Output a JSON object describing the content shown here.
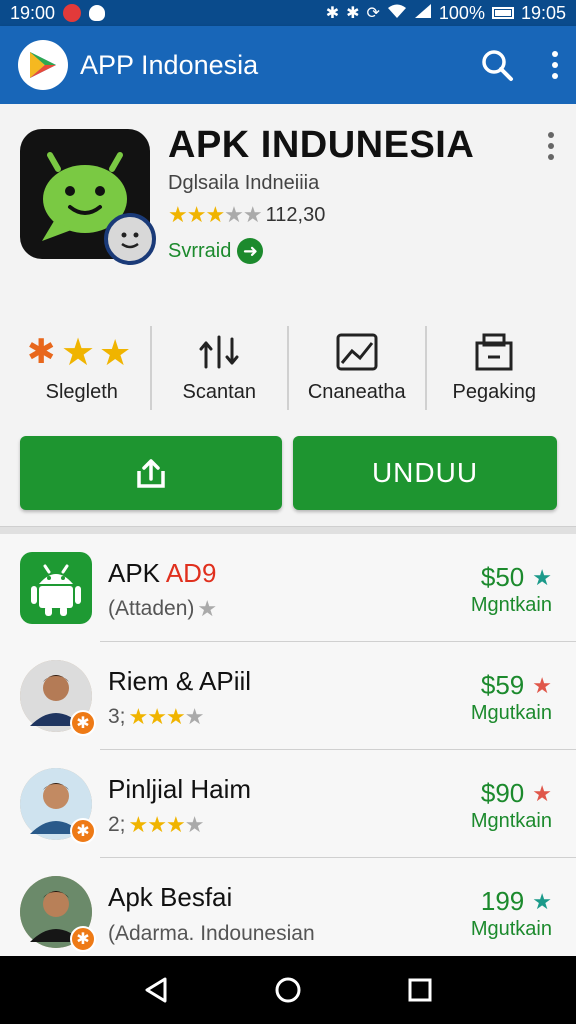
{
  "status_bar": {
    "time_left": "19:00",
    "battery": "100%",
    "time_right": "19:05"
  },
  "app_bar": {
    "title": "APP Indonesia",
    "icons": [
      "search-icon",
      "overflow-menu-icon"
    ]
  },
  "app": {
    "name": "APK INDUNESIA",
    "developer": "Dglsaila Indneiiia",
    "rating_count": "112,30",
    "rating_stars": 3.5,
    "link_label": "Svrraid"
  },
  "features": [
    {
      "label": "Slegleth",
      "icon": "stars-icon"
    },
    {
      "label": "Scantan",
      "icon": "transfer-icon"
    },
    {
      "label": "Cnaneatha",
      "icon": "image-chart-icon"
    },
    {
      "label": "Pegaking",
      "icon": "package-icon"
    }
  ],
  "buttons": {
    "download_label": "UNDUU"
  },
  "list": [
    {
      "title": "APK ",
      "title_highlight": "AD9",
      "subtitle": "(Attaden)",
      "price": "$50",
      "action": "Mgntkain",
      "star_color": "#1b9a8a"
    },
    {
      "title": "Riem & APiil",
      "subtitle": "3;",
      "price": "$59",
      "action": "Mgutkain",
      "star_color": "#e0574a"
    },
    {
      "title": "Pinljial Haim",
      "subtitle": "2;",
      "price": "$90",
      "action": "Mgntkain",
      "star_color": "#e0574a"
    },
    {
      "title": "Apk Besfai",
      "subtitle": "(Adarma. Indounesian",
      "price": "199",
      "action": "Mgutkain",
      "star_color": "#1b9a8a"
    }
  ],
  "colors": {
    "app_bar": "#1866b8",
    "status_bar": "#0a4b8c",
    "accent_green": "#1e9530",
    "star": "#f0b400"
  }
}
